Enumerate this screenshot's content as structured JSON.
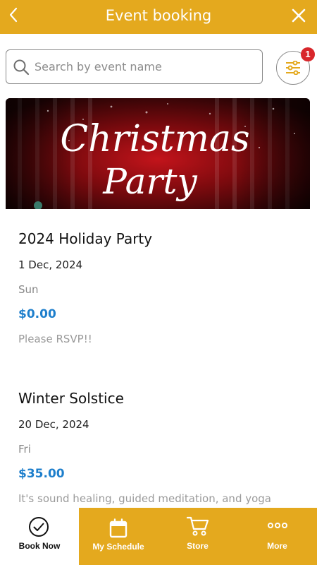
{
  "header": {
    "title": "Event booking"
  },
  "search": {
    "placeholder": "Search by event name"
  },
  "filter": {
    "badge_count": "1"
  },
  "banner": {
    "line1": "Christmas",
    "line2": "Party"
  },
  "events": [
    {
      "title": "2024 Holiday Party",
      "date": "1 Dec, 2024",
      "day": "Sun",
      "price": "$0.00",
      "description": "Please RSVP!!"
    },
    {
      "title": "Winter Solstice",
      "date": "20 Dec, 2024",
      "day": "Fri",
      "price": "$35.00",
      "description": "It's sound healing, guided meditation, and yoga"
    }
  ],
  "tabs": [
    {
      "label": "Book Now",
      "icon": "check-circle-icon"
    },
    {
      "label": "My Schedule",
      "icon": "calendar-icon"
    },
    {
      "label": "Store",
      "icon": "cart-icon"
    },
    {
      "label": "More",
      "icon": "more-dots-icon"
    }
  ],
  "colors": {
    "accent": "#E4A91E",
    "price": "#1E7FCC",
    "badge": "#D8262B"
  }
}
